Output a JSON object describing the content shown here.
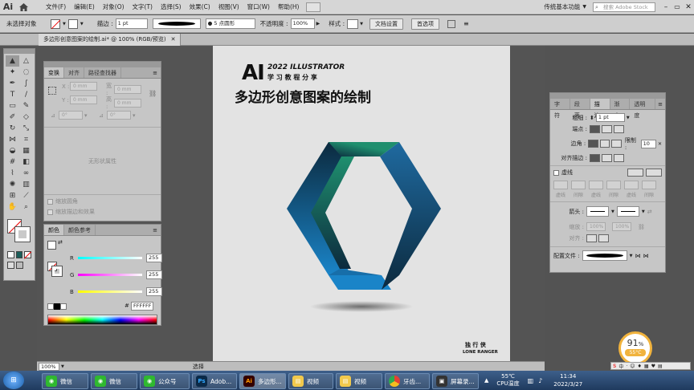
{
  "menubar": {
    "app_logo": "Ai",
    "items": [
      "文件(F)",
      "编辑(E)",
      "对象(O)",
      "文字(T)",
      "选择(S)",
      "效果(C)",
      "视图(V)",
      "窗口(W)",
      "帮助(H)"
    ],
    "workspace": "传统基本功能",
    "search_placeholder": "搜索 Adobe Stock"
  },
  "controlbar": {
    "selection": "未选择对象",
    "stroke_label": "描边 :",
    "stroke_value": "1 pt",
    "brush_value": "5 点圆形",
    "opacity_label": "不透明度 :",
    "opacity_value": "100%",
    "style_label": "样式 :",
    "doc_setup": "文档设置",
    "preferences": "首选项"
  },
  "document": {
    "tab_title": "多边形创意图案的绘制.ai* @ 100% (RGB/预览)"
  },
  "transform_panel": {
    "tabs": [
      "变换",
      "对齐",
      "路径查找器"
    ],
    "x_label": "X :",
    "x_value": "0 mm",
    "y_label": "Y :",
    "y_value": "0 mm",
    "w_label": "宽 :",
    "w_value": "0 mm",
    "h_label": "高 :",
    "h_value": "0 mm",
    "angle_value": "0°",
    "shear_value": "0°",
    "no_shape": "无形状属性",
    "scale_corners": "缩放圆角",
    "scale_strokes": "缩放描边和效果"
  },
  "color_panel": {
    "tabs": [
      "颜色",
      "颜色参考"
    ],
    "r_label": "R",
    "r_value": "255",
    "g_label": "G",
    "g_value": "255",
    "b_label": "B",
    "b_value": "255",
    "hex_label": "#",
    "hex_value": "FFFFFF"
  },
  "stroke_panel": {
    "tabs": [
      "字符",
      "段落",
      "描边",
      "渐变",
      "透明度"
    ],
    "weight_label": "粗细 :",
    "weight_value": "1 pt",
    "cap_label": "端点 :",
    "corner_label": "边角 :",
    "limit_label": "限制 :",
    "limit_value": "10",
    "align_label": "对齐描边 :",
    "dashed_label": "虚线",
    "dash_labels": [
      "虚线",
      "间隙",
      "虚线",
      "间隙",
      "虚线",
      "间隙"
    ],
    "arrow_label": "箭头 :",
    "scale_label": "缩放 :",
    "scale_value1": "100%",
    "scale_value2": "100%",
    "align2_label": "对齐 :",
    "profile_label": "配置文件 :"
  },
  "artboard": {
    "logo_ai": "AI",
    "year_line": "2022 ILLUSTRATOR",
    "sub_line": "学 习 教 程 分 享",
    "title": "多边形创意图案的绘制",
    "author_cn": "独 行 侠",
    "author_en": "LONE RANGER"
  },
  "statusbar": {
    "zoom": "100%",
    "tool": "选择"
  },
  "cpu_widget": {
    "percent": "91",
    "percent_sign": "%",
    "temp": "55°C"
  },
  "taskbar": {
    "items": [
      {
        "icon": "WeChat",
        "label": "微信"
      },
      {
        "icon": "WeChat",
        "label": "微信"
      },
      {
        "icon": "WeChat",
        "label": "公众号"
      },
      {
        "icon": "Ps",
        "label": "Adob..."
      },
      {
        "icon": "Ai",
        "label": "多边形..."
      },
      {
        "icon": "folder",
        "label": "视频"
      },
      {
        "icon": "folder",
        "label": "视频"
      },
      {
        "icon": "chrome",
        "label": "牙齿..."
      },
      {
        "icon": "rec",
        "label": "屏幕录..."
      }
    ],
    "cpu_temp": "55℃",
    "cpu_label": "CPU温度",
    "time": "11:34",
    "date": "2022/3/27"
  },
  "colors": {
    "hex_teal": "#1f8f6e",
    "hex_dark": "#0c2a3e",
    "hex_blue": "#1a84c8"
  }
}
